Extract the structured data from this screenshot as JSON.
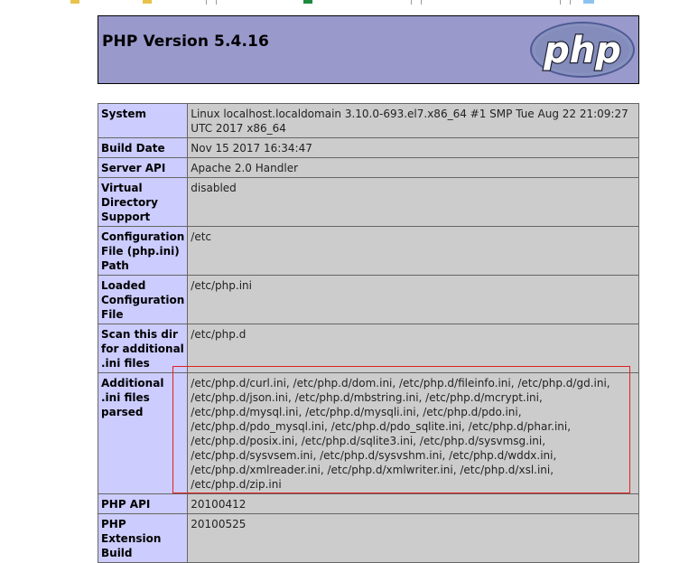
{
  "header": {
    "title": "PHP Version 5.4.16",
    "logo_text": "php"
  },
  "rows": [
    {
      "key": "System",
      "value": "Linux localhost.localdomain 3.10.0-693.el7.x86_64 #1 SMP Tue Aug 22 21:09:27 UTC 2017 x86_64"
    },
    {
      "key": "Build Date",
      "value": "Nov 15 2017 16:34:47"
    },
    {
      "key": "Server API",
      "value": "Apache 2.0 Handler"
    },
    {
      "key": "Virtual Directory Support",
      "value": "disabled"
    },
    {
      "key": "Configuration File (php.ini) Path",
      "value": "/etc"
    },
    {
      "key": "Loaded Configuration File",
      "value": "/etc/php.ini"
    },
    {
      "key": "Scan this dir for additional .ini files",
      "value": "/etc/php.d"
    },
    {
      "key": "Additional .ini files parsed",
      "value": "/etc/php.d/curl.ini, /etc/php.d/dom.ini, /etc/php.d/fileinfo.ini, /etc/php.d/gd.ini, /etc/php.d/json.ini, /etc/php.d/mbstring.ini, /etc/php.d/mcrypt.ini, /etc/php.d/mysql.ini, /etc/php.d/mysqli.ini, /etc/php.d/pdo.ini, /etc/php.d/pdo_mysql.ini, /etc/php.d/pdo_sqlite.ini, /etc/php.d/phar.ini, /etc/php.d/posix.ini, /etc/php.d/sqlite3.ini, /etc/php.d/sysvmsg.ini, /etc/php.d/sysvsem.ini, /etc/php.d/sysvshm.ini, /etc/php.d/wddx.ini, /etc/php.d/xmlreader.ini, /etc/php.d/xmlwriter.ini, /etc/php.d/xsl.ini, /etc/php.d/zip.ini"
    },
    {
      "key": "PHP API",
      "value": "20100412"
    },
    {
      "key": "PHP Extension Build",
      "value": "20100525"
    }
  ],
  "annotation": {
    "highlight_color": "#e02020"
  },
  "colors": {
    "header_bg": "#9999cc",
    "key_bg": "#ccccff",
    "value_bg": "#cccccc"
  }
}
